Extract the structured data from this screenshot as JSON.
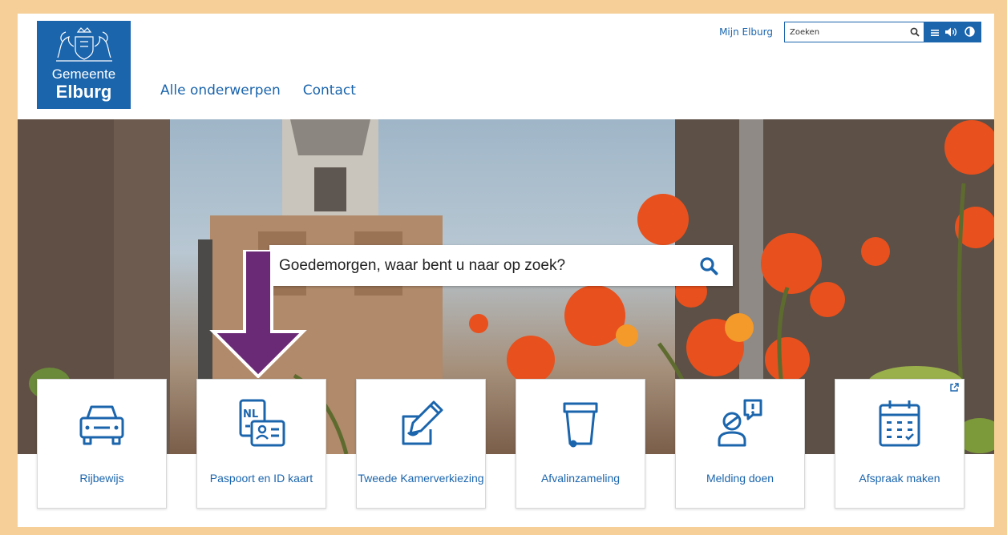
{
  "header": {
    "logo": {
      "line1": "Gemeente",
      "line2": "Elburg"
    },
    "mijn": "Mijn Elburg",
    "search": {
      "placeholder": "Zoeken"
    },
    "nav": [
      {
        "label": "Alle onderwerpen"
      },
      {
        "label": "Contact"
      }
    ],
    "accessibility": [
      "menu-icon",
      "speaker-icon",
      "contrast-icon"
    ]
  },
  "hero": {
    "search": {
      "placeholder": "Goedemorgen, waar bent u naar op zoek?"
    }
  },
  "tiles": [
    {
      "label": "Rijbewijs",
      "icon": "car-icon"
    },
    {
      "label": "Paspoort en ID kaart",
      "icon": "passport-id-icon"
    },
    {
      "label": "Tweede Kamerverkiezing",
      "icon": "ballot-pencil-icon"
    },
    {
      "label": "Afvalinzameling",
      "icon": "waste-bin-icon"
    },
    {
      "label": "Melding doen",
      "icon": "person-alert-icon"
    },
    {
      "label": "Afspraak maken",
      "icon": "calendar-icon",
      "external": true
    }
  ],
  "colors": {
    "brand": "#1b65ad",
    "annotation_arrow": "#6b2a76",
    "outer_frame": "#f6cf98"
  }
}
